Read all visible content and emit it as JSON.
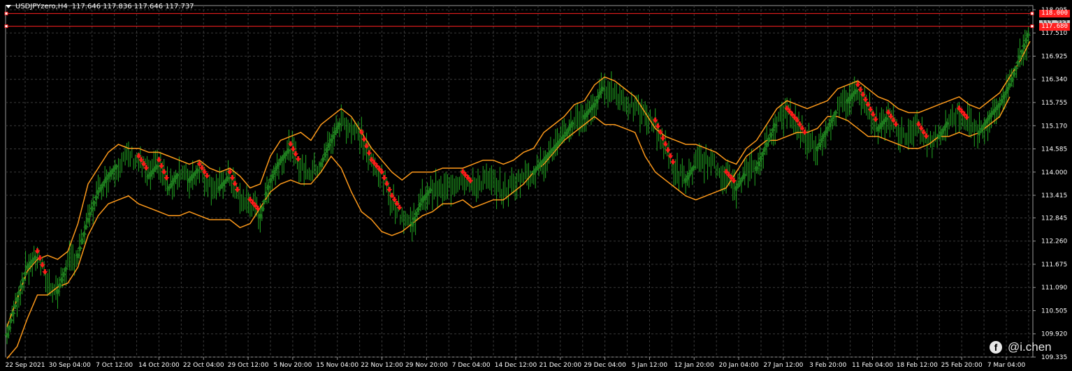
{
  "header": {
    "symbol": "USDJPYzero,H4",
    "ohlc": "117.646 117.836 117.646 117.737"
  },
  "levels": [
    {
      "value": "118.000",
      "color": "#ff2020"
    },
    {
      "value": "117.737",
      "color": "#cccccc"
    },
    {
      "value": "117.680",
      "color": "#ff2020"
    }
  ],
  "watermark": {
    "icon": "facebook-icon",
    "text": "@i.chen"
  },
  "colors": {
    "background": "#000000",
    "grid": "#3a3a3a",
    "bars": "#22a822",
    "band": "#ff9a1a",
    "up_arrow": "#1e7a1e",
    "down_arrow": "#ff1a1a",
    "level_line": "#ff2020"
  },
  "chart_data": {
    "type": "line",
    "title": "USDJPYzero,H4",
    "ylim": [
      109.335,
      118.2
    ],
    "y_ticks": [
      "118.095",
      "117.510",
      "116.925",
      "116.340",
      "115.755",
      "115.170",
      "114.585",
      "114.000",
      "113.415",
      "112.845",
      "112.260",
      "111.675",
      "111.090",
      "110.505",
      "109.920",
      "109.335"
    ],
    "x_ticks": [
      "22 Sep 2021",
      "30 Sep 04:00",
      "7 Oct 12:00",
      "14 Oct 20:00",
      "22 Oct 04:00",
      "29 Oct 12:00",
      "5 Nov 20:00",
      "15 Nov 04:00",
      "22 Nov 12:00",
      "29 Nov 20:00",
      "7 Dec 04:00",
      "14 Dec 12:00",
      "21 Dec 20:00",
      "29 Dec 04:00",
      "5 Jan 12:00",
      "12 Jan 20:00",
      "20 Jan 04:00",
      "27 Jan 12:00",
      "3 Feb 20:00",
      "11 Feb 04:00",
      "18 Feb 12:00",
      "25 Feb 20:00",
      "7 Mar 04:00"
    ],
    "grid": true,
    "series": [
      {
        "values": [
          109.9,
          110.8,
          111.6,
          111.9,
          111.2,
          111.0,
          111.7,
          111.9,
          112.8,
          113.5,
          113.9,
          114.2,
          114.4,
          114.3,
          113.9,
          114.2,
          113.6,
          114.0,
          113.8,
          114.1,
          113.7,
          113.6,
          113.9,
          113.3,
          113.2,
          112.9,
          113.8,
          114.3,
          114.6,
          114.1,
          114.0,
          114.2,
          114.8,
          115.3,
          115.1,
          114.9,
          114.2,
          113.9,
          113.3,
          112.9,
          112.7,
          113.3,
          113.6,
          113.5,
          113.7,
          113.9,
          113.6,
          113.8,
          113.7,
          113.5,
          113.7,
          113.9,
          114.0,
          114.3,
          114.6,
          114.9,
          115.3,
          115.4,
          115.7,
          116.2,
          116.0,
          115.8,
          115.6,
          115.4,
          115.2,
          114.6,
          114.0,
          113.8,
          114.2,
          114.3,
          114.1,
          113.9,
          113.6,
          114.0,
          114.1,
          114.7,
          115.3,
          115.5,
          115.2,
          114.8,
          114.6,
          115.1,
          115.6,
          115.8,
          116.1,
          115.6,
          115.1,
          115.4,
          115.0,
          114.9,
          115.1,
          114.7,
          114.9,
          115.3,
          115.5,
          115.2,
          115.0,
          115.4,
          115.7,
          116.2,
          116.9,
          117.6
        ]
      },
      {
        "values": [
          110.1,
          110.8,
          111.5,
          111.8,
          111.9,
          111.8,
          112.0,
          112.7,
          113.7,
          114.1,
          114.5,
          114.7,
          114.6,
          114.6,
          114.5,
          114.5,
          114.4,
          114.3,
          114.2,
          114.3,
          114.1,
          114.0,
          114.1,
          113.9,
          113.6,
          113.7,
          114.4,
          114.8,
          114.9,
          115.0,
          114.8,
          115.2,
          115.4,
          115.6,
          115.4,
          115.0,
          114.6,
          114.3,
          114.0,
          113.8,
          114.0,
          114.0,
          114.0,
          114.1,
          114.1,
          114.1,
          114.2,
          114.3,
          114.3,
          114.2,
          114.3,
          114.5,
          114.6,
          115.0,
          115.2,
          115.4,
          115.7,
          115.8,
          116.2,
          116.4,
          116.3,
          116.1,
          115.9,
          115.5,
          115.1,
          114.9,
          114.8,
          114.7,
          114.7,
          114.6,
          114.5,
          114.3,
          114.2,
          114.6,
          114.8,
          115.2,
          115.6,
          115.8,
          115.7,
          115.6,
          115.7,
          115.8,
          116.1,
          116.2,
          116.3,
          116.1,
          115.9,
          115.8,
          115.6,
          115.5,
          115.5,
          115.6,
          115.7,
          115.8,
          115.9,
          115.7,
          115.6,
          115.8,
          116.0,
          116.4,
          116.8,
          117.3
        ]
      },
      {
        "values": [
          109.3,
          109.6,
          110.3,
          110.9,
          110.9,
          111.1,
          111.2,
          111.6,
          112.4,
          112.9,
          113.2,
          113.3,
          113.4,
          113.2,
          113.1,
          113.0,
          112.9,
          112.9,
          113.0,
          112.9,
          112.8,
          112.8,
          112.8,
          112.6,
          112.7,
          113.1,
          113.5,
          113.7,
          113.8,
          113.7,
          113.7,
          114.0,
          114.4,
          114.1,
          113.5,
          113.0,
          112.8,
          112.5,
          112.4,
          112.5,
          112.7,
          112.9,
          113.0,
          113.2,
          113.2,
          113.3,
          113.1,
          113.2,
          113.3,
          113.3,
          113.5,
          113.7,
          114.0,
          114.2,
          114.5,
          114.8,
          115.0,
          115.2,
          115.4,
          115.2,
          115.2,
          115.1,
          115.0,
          114.4,
          114.0,
          113.8,
          113.6,
          113.4,
          113.3,
          113.4,
          113.5,
          113.6,
          114.0,
          114.4,
          114.6,
          114.8,
          114.8,
          114.9,
          115.0,
          115.0,
          115.1,
          115.4,
          115.4,
          115.3,
          115.1,
          114.9,
          114.9,
          114.8,
          114.7,
          114.6,
          114.6,
          114.7,
          114.9,
          114.9,
          115.0,
          114.9,
          115.0,
          115.2,
          115.4,
          115.9
        ]
      }
    ]
  }
}
